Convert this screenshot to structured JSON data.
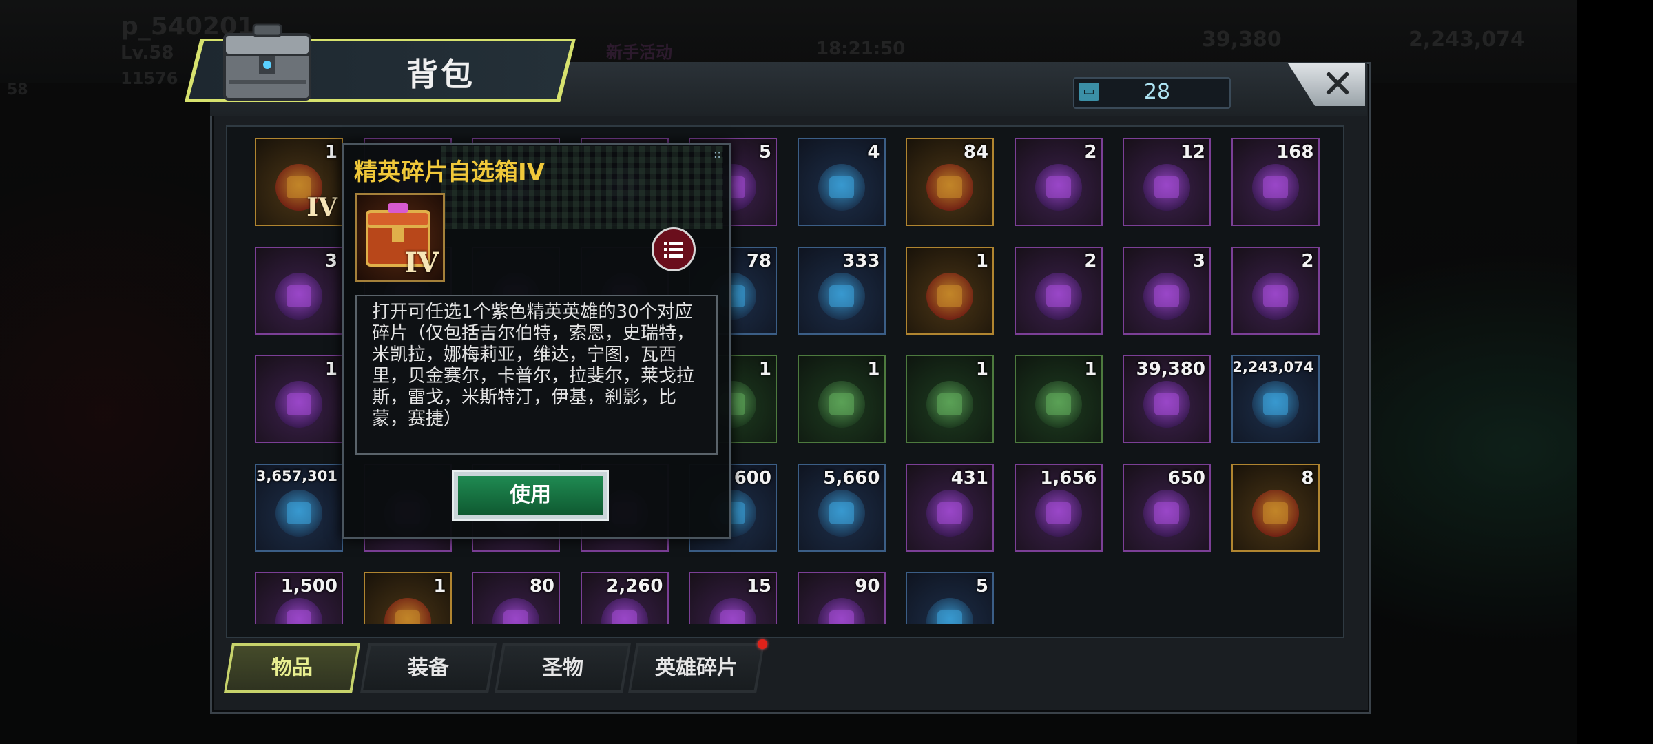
{
  "background": {
    "player_name": "p_540201",
    "level": "Lv.58",
    "power": "11576",
    "badge": "58",
    "event_label": "新手活动",
    "timer": "18:21:50",
    "diamonds": "39,380",
    "gold": "2,243,074"
  },
  "header": {
    "title": "背包",
    "capacity": "28",
    "close_label": "✕"
  },
  "popup": {
    "title": "精英碎片自选箱IV",
    "description": "打开可任选1个紫色精英英雄的30个对应碎片（仅包括吉尔伯特，索恩，史瑞特，米凯拉，娜梅莉亚，维达，宁图，瓦西里，贝金赛尔，卡普尔，拉斐尔，莱戈拉斯，雷戈，米斯特汀，伊基，刹影，比蒙，赛捷）",
    "use_label": "使用",
    "icon_roman": "IV"
  },
  "items": [
    {
      "count": "1",
      "rarity": "gold",
      "icon": "elite-chest-iv-icon",
      "roman": "IV"
    },
    {
      "count": "",
      "rarity": "purple",
      "icon": "hidden-item-icon"
    },
    {
      "count": "",
      "rarity": "purple",
      "icon": "hidden-item-icon"
    },
    {
      "count": "",
      "rarity": "purple",
      "icon": "hidden-item-icon"
    },
    {
      "count": "5",
      "rarity": "purple",
      "icon": "speedup-card-icon"
    },
    {
      "count": "4",
      "rarity": "blue",
      "icon": "speedup-4h-card-icon"
    },
    {
      "count": "84",
      "rarity": "gold",
      "icon": "red-bottle-cap-icon"
    },
    {
      "count": "2",
      "rarity": "purple",
      "icon": "cube-frame-icon"
    },
    {
      "count": "12",
      "rarity": "purple",
      "icon": "film-reel-icon"
    },
    {
      "count": "168",
      "rarity": "purple",
      "icon": "purple-bottle-cap-icon"
    },
    {
      "count": "3",
      "rarity": "purple",
      "icon": "purple-chip-icon"
    },
    {
      "count": "",
      "rarity": "purple",
      "icon": "hidden-item-icon"
    },
    {
      "count": "",
      "rarity": "purple",
      "icon": "hidden-item-icon"
    },
    {
      "count": "",
      "rarity": "purple",
      "icon": "hidden-item-icon"
    },
    {
      "count": "78",
      "rarity": "blue",
      "icon": "red-chip-icon"
    },
    {
      "count": "333",
      "rarity": "blue",
      "icon": "bullet-icon"
    },
    {
      "count": "1",
      "rarity": "gold",
      "icon": "gold-gear-box-icon"
    },
    {
      "count": "2",
      "rarity": "purple",
      "icon": "purple-shirt-box-icon"
    },
    {
      "count": "3",
      "rarity": "purple",
      "icon": "purple-hat-box-icon"
    },
    {
      "count": "2",
      "rarity": "purple",
      "icon": "purple-gun-box-icon"
    },
    {
      "count": "1",
      "rarity": "purple",
      "icon": "purple-boots-box-icon"
    },
    {
      "count": "",
      "rarity": "purple",
      "icon": "hidden-item-icon"
    },
    {
      "count": "",
      "rarity": "purple",
      "icon": "hidden-item-icon"
    },
    {
      "count": "",
      "rarity": "purple",
      "icon": "hidden-item-icon"
    },
    {
      "count": "1",
      "rarity": "green",
      "icon": "green-gloves-box-icon"
    },
    {
      "count": "1",
      "rarity": "green",
      "icon": "green-weapon-box-icon"
    },
    {
      "count": "1",
      "rarity": "green",
      "icon": "green-boots-box-icon"
    },
    {
      "count": "1",
      "rarity": "green",
      "icon": "green-shirt-box-icon"
    },
    {
      "count": "39,380",
      "rarity": "purple",
      "icon": "diamond-icon"
    },
    {
      "count": "2,243,074",
      "rarity": "blue",
      "icon": "gold-coins-icon"
    },
    {
      "count": "3,657,301",
      "rarity": "blue",
      "icon": "green-canister-icon"
    },
    {
      "count": "",
      "rarity": "purple",
      "icon": "hidden-item-icon"
    },
    {
      "count": "",
      "rarity": "purple",
      "icon": "hidden-item-icon"
    },
    {
      "count": "",
      "rarity": "purple",
      "icon": "hidden-item-icon"
    },
    {
      "count": "600",
      "rarity": "blue",
      "icon": "eagle-badge-icon"
    },
    {
      "count": "5,660",
      "rarity": "blue",
      "icon": "crystal-shard-icon"
    },
    {
      "count": "431",
      "rarity": "purple",
      "icon": "fist-icon"
    },
    {
      "count": "1,656",
      "rarity": "purple",
      "icon": "puzzle-piece-icon"
    },
    {
      "count": "650",
      "rarity": "purple",
      "icon": "ship-medal-icon"
    },
    {
      "count": "8",
      "rarity": "gold",
      "icon": "gold-ship-medal-icon"
    },
    {
      "count": "1,500",
      "rarity": "purple",
      "icon": "red-emblem-icon"
    },
    {
      "count": "1",
      "rarity": "gold",
      "icon": "star-crate-icon"
    },
    {
      "count": "80",
      "rarity": "purple",
      "icon": "lightning-orb-icon"
    },
    {
      "count": "2,260",
      "rarity": "purple",
      "icon": "pink-crystal-icon"
    },
    {
      "count": "15",
      "rarity": "purple",
      "icon": "gold-glove-icon"
    },
    {
      "count": "90",
      "rarity": "purple",
      "icon": "red-target-icon"
    },
    {
      "count": "5",
      "rarity": "blue",
      "icon": "dna-helix-icon"
    }
  ],
  "tabs": [
    {
      "label": "物品",
      "active": true
    },
    {
      "label": "装备",
      "active": false
    },
    {
      "label": "圣物",
      "active": false
    },
    {
      "label": "英雄碎片",
      "active": false,
      "badge": true
    }
  ],
  "colors": {
    "accent_gold": "#f0c83a",
    "tab_active": "#c7d36b",
    "use_button": "#1f8a52",
    "capacity_text": "#aee3f2"
  }
}
